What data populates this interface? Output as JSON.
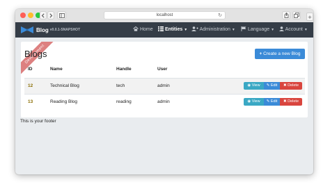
{
  "browser": {
    "address": "localhost",
    "back_icon": "chevron-left-icon",
    "forward_icon": "chevron-right-icon",
    "reload_icon": "reload-icon",
    "share_icon": "share-icon",
    "tabs_icon": "tabs-icon",
    "new_tab": "+"
  },
  "navbar": {
    "brand": "Blog",
    "version": "v0.0.1-SNAPSHOT",
    "items": [
      {
        "label": "Home",
        "icon": "home-icon"
      },
      {
        "label": "Entities",
        "icon": "list-icon",
        "active": true
      },
      {
        "label": "Administration",
        "icon": "user-plus-icon"
      },
      {
        "label": "Language",
        "icon": "flag-icon"
      },
      {
        "label": "Account",
        "icon": "user-icon"
      }
    ],
    "background": "#353d47"
  },
  "ribbon": "Development",
  "page": {
    "title": "Blogs",
    "create_button": "Create a new Blog",
    "columns": [
      "ID",
      "Name",
      "Handle",
      "User"
    ],
    "rows": [
      {
        "id": "12",
        "name": "Technical Blog",
        "handle": "tech",
        "user": "admin"
      },
      {
        "id": "13",
        "name": "Reading Blog",
        "handle": "reading",
        "user": "admin"
      }
    ],
    "actions": {
      "view": "View",
      "edit": "Edit",
      "delete": "Delete"
    }
  },
  "footer": "This is your footer",
  "colors": {
    "primary": "#3b8bd8",
    "info": "#3aa8c4",
    "danger": "#d9453e",
    "ribbon": "#c83232"
  }
}
